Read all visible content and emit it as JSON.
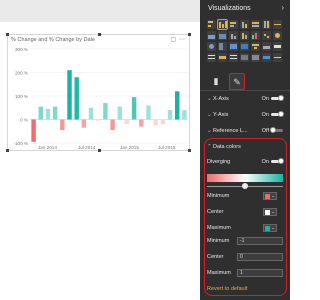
{
  "chart": {
    "title": "% Change and % Change by Date",
    "card_icon_focus": "focus-icon",
    "card_icon_more": "more-icon"
  },
  "chart_data": {
    "type": "bar",
    "title": "% Change and % Change by Date",
    "x_tick_labels": [
      "Jan 2014",
      "Jul 2014",
      "Jan 2015",
      "Jul 2015"
    ],
    "y_tick_labels": [
      "300 %",
      "200 %",
      "100 %",
      "0 %",
      "-100 %"
    ],
    "ylim": [
      -100,
      300
    ],
    "grid": true,
    "series": [
      {
        "values": [
          -95,
          55,
          45,
          55,
          -45,
          210,
          180,
          -35,
          50,
          -5,
          70,
          -45,
          55,
          -20,
          95,
          -30,
          60,
          -25,
          -20,
          40,
          120,
          40
        ]
      }
    ],
    "bar_colors": [
      "#f26b6b",
      "#7fd9cb",
      "#9de2d8",
      "#7fd9cb",
      "#f79898",
      "#1ab3a0",
      "#22b8a6",
      "#f7a3a3",
      "#9de2d8",
      "#fbd6d6",
      "#7fd9cb",
      "#f79898",
      "#9de2d8",
      "#fbd6d6",
      "#4fc7b6",
      "#f7a3a3",
      "#9de2d8",
      "#fbd6d6",
      "#fbd6d6",
      "#9de2d8",
      "#1ab3a0",
      "#9de2d8"
    ]
  },
  "pane": {
    "title": "Visualizations",
    "collapse_icon": "chevron-right-icon",
    "fields_tab_icon": "fields-icon",
    "format_tab_icon": "paint-roller-icon",
    "rows": [
      {
        "label": "X-Axis",
        "state": "On"
      },
      {
        "label": "Y-Axis",
        "state": "On"
      },
      {
        "label": "Reference L...",
        "state": "Off"
      }
    ],
    "data_colors": {
      "header": "Data colors",
      "diverging_label": "Diverging",
      "diverging_state": "On",
      "minimum_label": "Minimum",
      "center_label": "Center",
      "maximum_label": "Maximum",
      "min_color": "#f26b6b",
      "center_color": "#ffffff",
      "max_color": "#1ab3a0",
      "minimum_value_label": "Minimum",
      "minimum_value": "-1",
      "center_value_label": "Center",
      "center_value": "0",
      "maximum_value_label": "Maximum",
      "maximum_value": "1",
      "revert": "Revert to default"
    }
  },
  "colors": {
    "accent_highlight": "#d51f26",
    "revert_link": "#e9b52b",
    "pane_bg": "#2f2f2f"
  }
}
